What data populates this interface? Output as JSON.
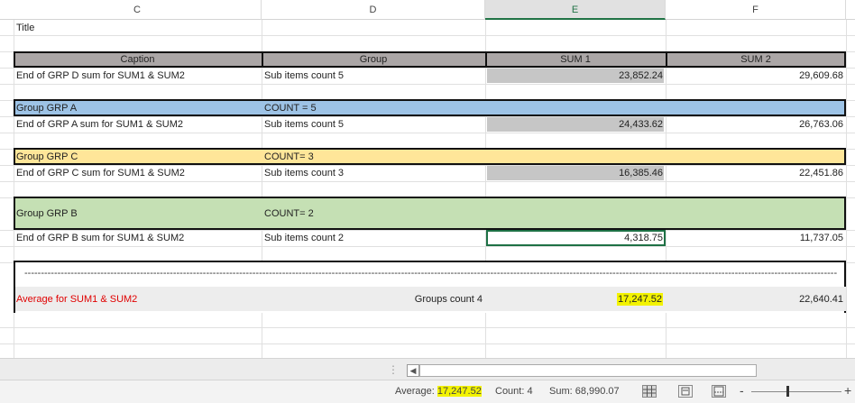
{
  "columns": [
    "C",
    "D",
    "E",
    "F"
  ],
  "title_text": "Title",
  "headers": {
    "caption": "Caption",
    "group": "Group",
    "sum1": "SUM 1",
    "sum2": "SUM 2"
  },
  "rows": [
    {
      "caption": "End of GRP D sum for SUM1 & SUM2",
      "group": "Sub items count 5",
      "sum1": "23,852.24",
      "sum2": "29,609.68"
    },
    {
      "caption": "Group GRP A",
      "group": "COUNT = 5"
    },
    {
      "caption": "End of GRP A sum for SUM1 & SUM2",
      "group": "Sub items count 5",
      "sum1": "24,433.62",
      "sum2": "26,763.06"
    },
    {
      "caption": "Group GRP C",
      "group": "COUNT= 3"
    },
    {
      "caption": "End of GRP C sum for SUM1 & SUM2",
      "group": "Sub items count 3",
      "sum1": "16,385.46",
      "sum2": "22,451.86"
    },
    {
      "caption": "Group GRP B",
      "group": "COUNT= 2"
    },
    {
      "caption": "End of GRP B sum for SUM1 & SUM2",
      "group": "Sub items count 2",
      "sum1": "4,318.75",
      "sum2": "11,737.05"
    }
  ],
  "summary": {
    "dashes": "------------------------------------------------------------------------------------------------------------------------------------------------------------------------------------------------------------------------------------------------------------------------------------------------",
    "caption": "Average for SUM1 & SUM2",
    "groups_count": "Groups count 4",
    "sum1": "17,247.52",
    "sum2": "22,640.41"
  },
  "colors": {
    "group_a": "#9dc3e6",
    "group_c": "#ffe699",
    "group_b": "#c5e0b4",
    "summary_caption": "#e00000",
    "highlight": "#f3f300"
  },
  "statusbar": {
    "average_label": "Average:",
    "average_value": "17,247.52",
    "count": "Count: 4",
    "sum": "Sum: 68,990.07",
    "zoom_minus": "-",
    "zoom_plus": "+"
  },
  "scroll": {
    "dots": "⋮",
    "left_arrow": "◀"
  },
  "icons": [
    "normal-view-icon",
    "page-layout-icon",
    "page-break-icon"
  ]
}
